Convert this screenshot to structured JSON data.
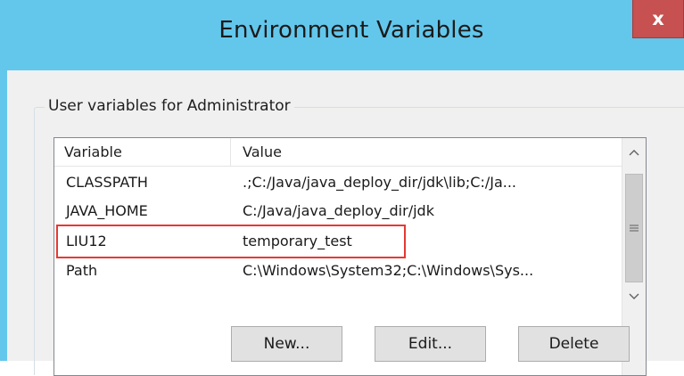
{
  "window": {
    "title": "Environment Variables",
    "close_label": "x"
  },
  "user_group": {
    "label": "User variables for Administrator"
  },
  "listview": {
    "columns": [
      "Variable",
      "Value"
    ],
    "rows": [
      {
        "variable": "CLASSPATH",
        "value": ".;C:/Java/java_deploy_dir/jdk\\lib;C:/Ja..."
      },
      {
        "variable": "JAVA_HOME",
        "value": "C:/Java/java_deploy_dir/jdk"
      },
      {
        "variable": "LIU12",
        "value": "temporary_test"
      },
      {
        "variable": "Path",
        "value": "C:\\Windows\\System32;C:\\Windows\\Sys..."
      }
    ],
    "highlighted_row": "LIU12"
  },
  "buttons": {
    "new": "New...",
    "edit": "Edit...",
    "delete": "Delete"
  },
  "colors": {
    "title_bar": "#63c7ec",
    "close_button": "#c75050",
    "highlight_box": "#e53935"
  }
}
